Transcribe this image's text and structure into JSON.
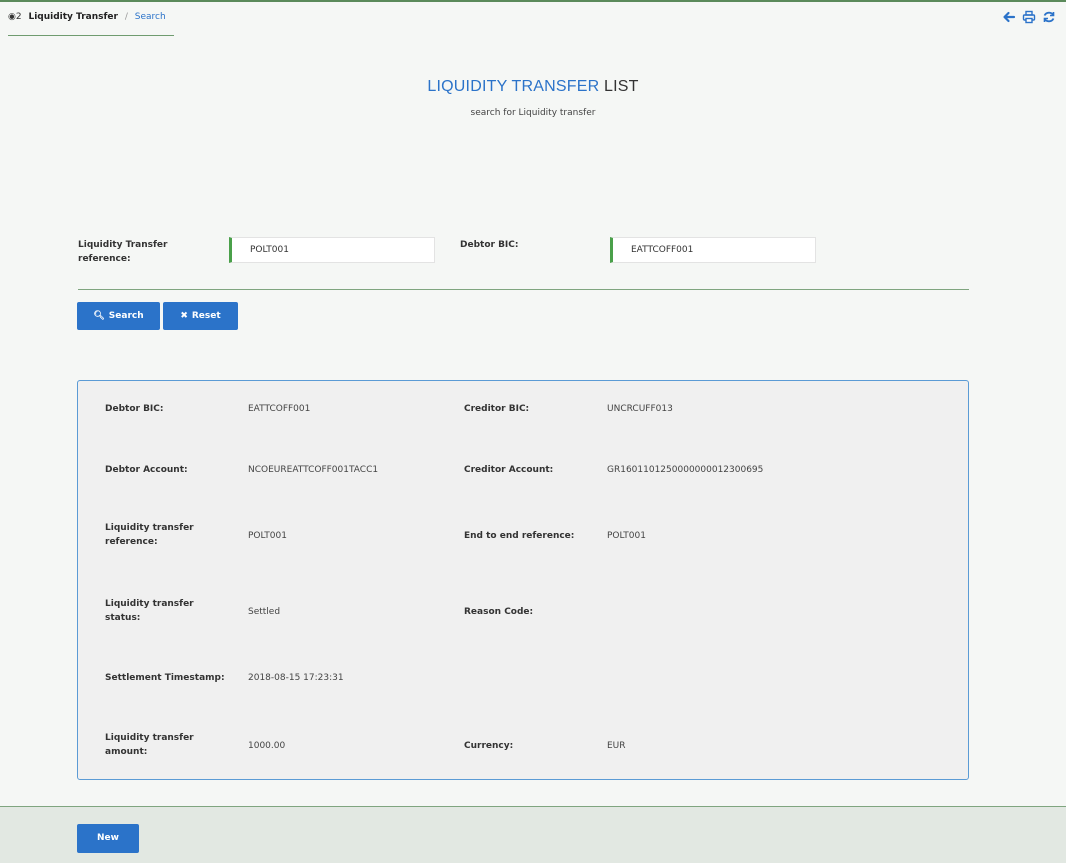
{
  "breadcrumb": {
    "count": "2",
    "label": "Liquidity Transfer",
    "separator": "/",
    "link": "Search"
  },
  "top_icons": [
    "back-arrow-icon",
    "print-icon",
    "refresh-icon"
  ],
  "page": {
    "title_highlight": "LIQUIDITY TRANSFER",
    "title_rest": "LIST",
    "subtitle": "search for Liquidity transfer"
  },
  "search": {
    "reference_label": "Liquidity Transfer reference:",
    "reference_value": "POLT001",
    "debtor_bic_label": "Debtor BIC:",
    "debtor_bic_value": "EATTCOFF001",
    "search_button": "Search",
    "reset_button": "Reset"
  },
  "result": {
    "debtor_bic_label": "Debtor BIC:",
    "debtor_bic_value": "EATTCOFF001",
    "creditor_bic_label": "Creditor BIC:",
    "creditor_bic_value": "UNCRCUFF013",
    "debtor_account_label": "Debtor Account:",
    "debtor_account_value": "NCOEUREATTCOFF001TACC1",
    "creditor_account_label": "Creditor Account:",
    "creditor_account_value": "GR1601101250000000012300695",
    "lt_reference_label": "Liquidity transfer reference:",
    "lt_reference_value": "POLT001",
    "e2e_reference_label": "End to end reference:",
    "e2e_reference_value": "POLT001",
    "status_label": "Liquidity transfer status:",
    "status_value": "Settled",
    "reason_code_label": "Reason Code:",
    "reason_code_value": "",
    "settlement_ts_label": "Settlement Timestamp:",
    "settlement_ts_value": "2018-08-15 17:23:31",
    "amount_label": "Liquidity transfer amount:",
    "amount_value": "1000.00",
    "currency_label": "Currency:",
    "currency_value": "EUR"
  },
  "footer": {
    "new_button": "New"
  },
  "colors": {
    "accent": "#2b73c9",
    "valid_marker": "#4aa04a",
    "panel_border": "#5b9bd5"
  }
}
